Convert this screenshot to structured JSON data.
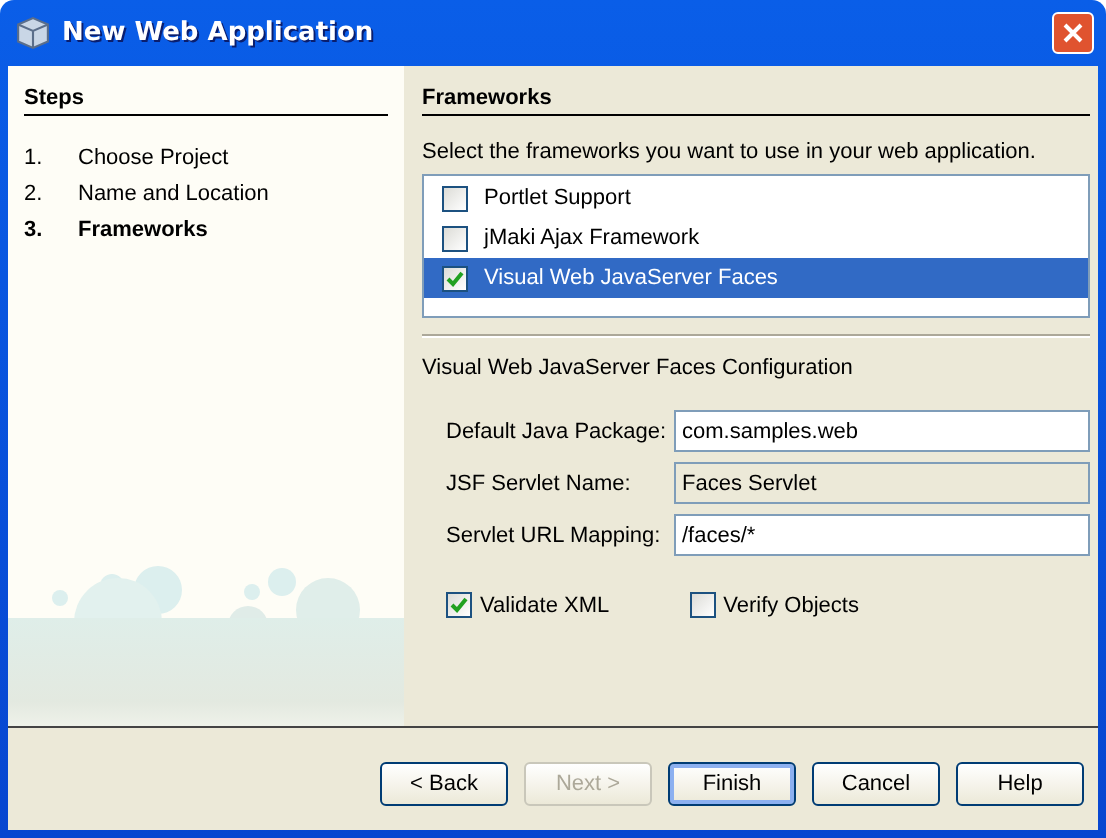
{
  "window": {
    "title": "New Web Application"
  },
  "steps": {
    "title": "Steps",
    "items": [
      {
        "number": "1.",
        "label": "Choose Project",
        "selected": false
      },
      {
        "number": "2.",
        "label": "Name and Location",
        "selected": false
      },
      {
        "number": "3.",
        "label": "Frameworks",
        "selected": true
      }
    ]
  },
  "panel": {
    "title": "Frameworks",
    "description": "Select the frameworks you want to use in your web application.",
    "frameworks": [
      {
        "label": "Portlet Support",
        "checked": false,
        "selected": false
      },
      {
        "label": "jMaki Ajax Framework",
        "checked": false,
        "selected": false
      },
      {
        "label": "Visual Web JavaServer Faces",
        "checked": true,
        "selected": true
      }
    ],
    "config_title": "Visual Web JavaServer Faces Configuration",
    "fields": [
      {
        "label": "Default Java Package:",
        "value": "com.samples.web",
        "disabled": false
      },
      {
        "label": "JSF Servlet Name:",
        "value": "Faces Servlet",
        "disabled": true
      },
      {
        "label": "Servlet URL Mapping:",
        "value": "/faces/*",
        "disabled": false
      }
    ],
    "options": [
      {
        "label": "Validate XML",
        "checked": true
      },
      {
        "label": "Verify Objects",
        "checked": false
      }
    ]
  },
  "buttons": [
    {
      "label": "< Back",
      "disabled": false,
      "default": false
    },
    {
      "label": "Next >",
      "disabled": true,
      "default": false
    },
    {
      "label": "Finish",
      "disabled": false,
      "default": true
    },
    {
      "label": "Cancel",
      "disabled": false,
      "default": false
    },
    {
      "label": "Help",
      "disabled": false,
      "default": false
    }
  ]
}
